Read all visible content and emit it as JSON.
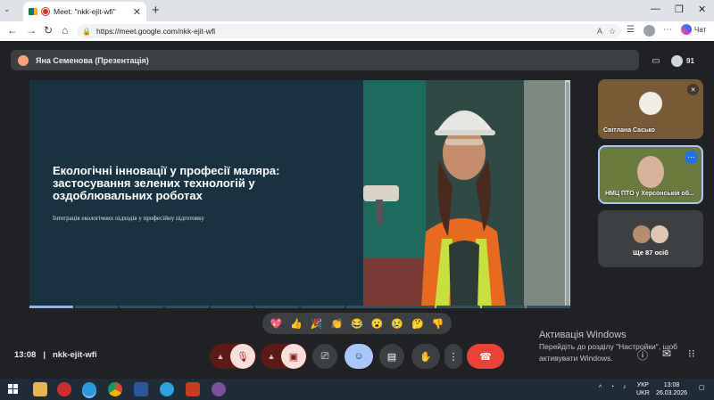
{
  "browser": {
    "tab_title": "Meet: \"nkk-ejit-wfi\"",
    "url": "https://meet.google.com/nkk-ejit-wfi",
    "copilot_label": "Чат"
  },
  "meet": {
    "presenter_label": "Яна Семенова (Презентація)",
    "participant_count": "91",
    "time": "13:08",
    "meeting_code": "nkk-ejit-wfi"
  },
  "slide": {
    "title": "Екологічні інновації у професії маляра: застосування зелених технологій у оздоблювальних роботах",
    "subtitle": "Інтеграція екологічних підходів у професійну підготовку"
  },
  "tiles": [
    {
      "name": "Світлана Сасько"
    },
    {
      "name": "НМЦ ПТО у Херсонській об..."
    },
    {
      "name": "Ще 87 осіб"
    }
  ],
  "reactions": [
    "💖",
    "👍",
    "🎉",
    "👏",
    "😂",
    "😮",
    "😢",
    "🤔",
    "👎"
  ],
  "windows_activation": {
    "title": "Активація Windows",
    "line1": "Перейдіть до розділу \"Настройки\", щоб",
    "line2": "активувати Windows."
  },
  "taskbar": {
    "lang1": "УКР",
    "lang2": "UKR",
    "clock_time": "13:08",
    "clock_date": "26.03.2026"
  }
}
